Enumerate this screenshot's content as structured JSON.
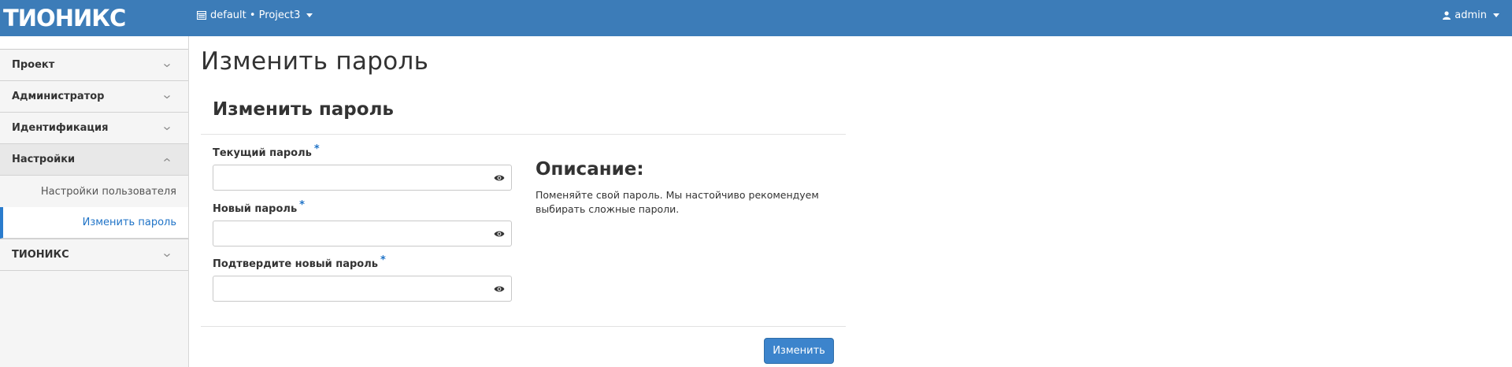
{
  "navbar": {
    "brand": "ТИОНИКС",
    "project_switch": "default • Project3",
    "user": "admin",
    "bg_color": "#3c7cb8"
  },
  "sidebar": {
    "items": [
      {
        "label": "Проект",
        "expanded": false
      },
      {
        "label": "Администратор",
        "expanded": false
      },
      {
        "label": "Идентификация",
        "expanded": false
      },
      {
        "label": "Настройки",
        "expanded": true
      }
    ],
    "sub_items": [
      {
        "label": "Настройки пользователя"
      },
      {
        "label": "Изменить пароль"
      }
    ],
    "last_item": {
      "label": "ТИОНИКС",
      "expanded": false
    }
  },
  "main": {
    "page_title": "Изменить пароль",
    "card_title": "Изменить пароль",
    "fields": [
      {
        "label": "Текущий пароль",
        "required": "*",
        "value": ""
      },
      {
        "label": "Новый пароль",
        "required": "*",
        "value": ""
      },
      {
        "label": "Подтвердите новый пароль",
        "required": "*",
        "value": ""
      }
    ],
    "description": {
      "title": "Описание:",
      "text": "Поменяйте свой пароль. Мы настойчиво рекомендуем выбирать сложные пароли."
    },
    "submit_label": "Изменить",
    "accent_color": "#3c84cc"
  }
}
